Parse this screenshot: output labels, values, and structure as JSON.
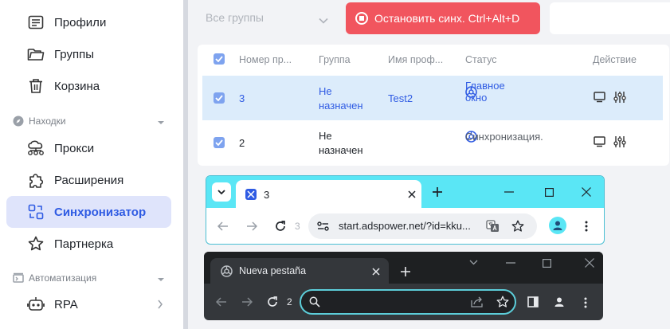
{
  "sidebar": {
    "items": [
      {
        "label": "Профили"
      },
      {
        "label": "Группы"
      },
      {
        "label": "Корзина"
      },
      {
        "label": "Прокси"
      },
      {
        "label": "Расширения"
      },
      {
        "label": "Синхронизатор"
      },
      {
        "label": "Партнерка"
      },
      {
        "label": "RPA"
      }
    ],
    "sections": [
      {
        "label": "Находки"
      },
      {
        "label": "Автоматизация"
      }
    ]
  },
  "toolbar": {
    "group_select": "Все группы",
    "stop_sync": "Остановить синх. Ctrl+Alt+D"
  },
  "table": {
    "headers": [
      "Номер пр...",
      "Группа",
      "Имя проф...",
      "Статус",
      "Действие"
    ],
    "rows": [
      {
        "number": "3",
        "group_l1": "Не",
        "group_l2": "назначен",
        "name": "Test2",
        "status": "Главное окно"
      },
      {
        "number": "2",
        "group_l1": "Не",
        "group_l2": "назначен",
        "name": "",
        "status": "Синхронизация."
      }
    ]
  },
  "browser1": {
    "tab_title": "3",
    "tab_number": "3",
    "url": "start.adspower.net/?id=kku..."
  },
  "browser2": {
    "tab_title": "Nueva pestaña",
    "tab_number": "2"
  },
  "colors": {
    "accent": "#2f5be3",
    "stop": "#f1555e",
    "selected_row": "#dcecfb",
    "chrome_cyan": "#5ae6f5"
  }
}
